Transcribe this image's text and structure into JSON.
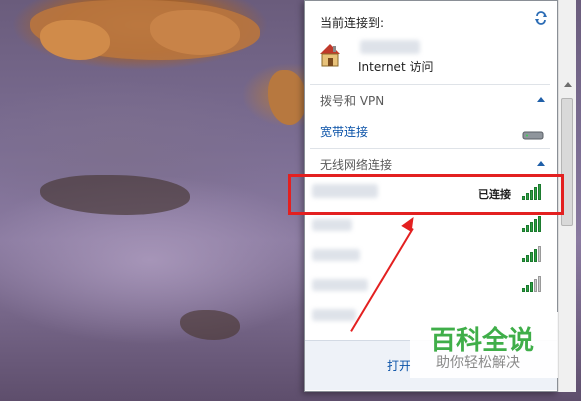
{
  "flyout": {
    "connected_to_label": "当前连接到:",
    "current_network_access": "Internet 访问",
    "dialup_section": "拨号和 VPN",
    "broadband_item": "宽带连接",
    "wireless_section": "无线网络连接",
    "connected_status": "已连接",
    "footer_link": "打开"
  },
  "watermark": {
    "title": "百科全说",
    "subtitle": "助你轻松解决"
  },
  "icons": {
    "refresh": "refresh-icon",
    "house": "network-house-icon",
    "modem": "modem-icon",
    "signal": "wifi-signal-icon"
  },
  "colors": {
    "accent_blue": "#0b53a8",
    "annotation_red": "#e32020",
    "signal_green": "#2ea043",
    "watermark_green": "#3fae49"
  }
}
